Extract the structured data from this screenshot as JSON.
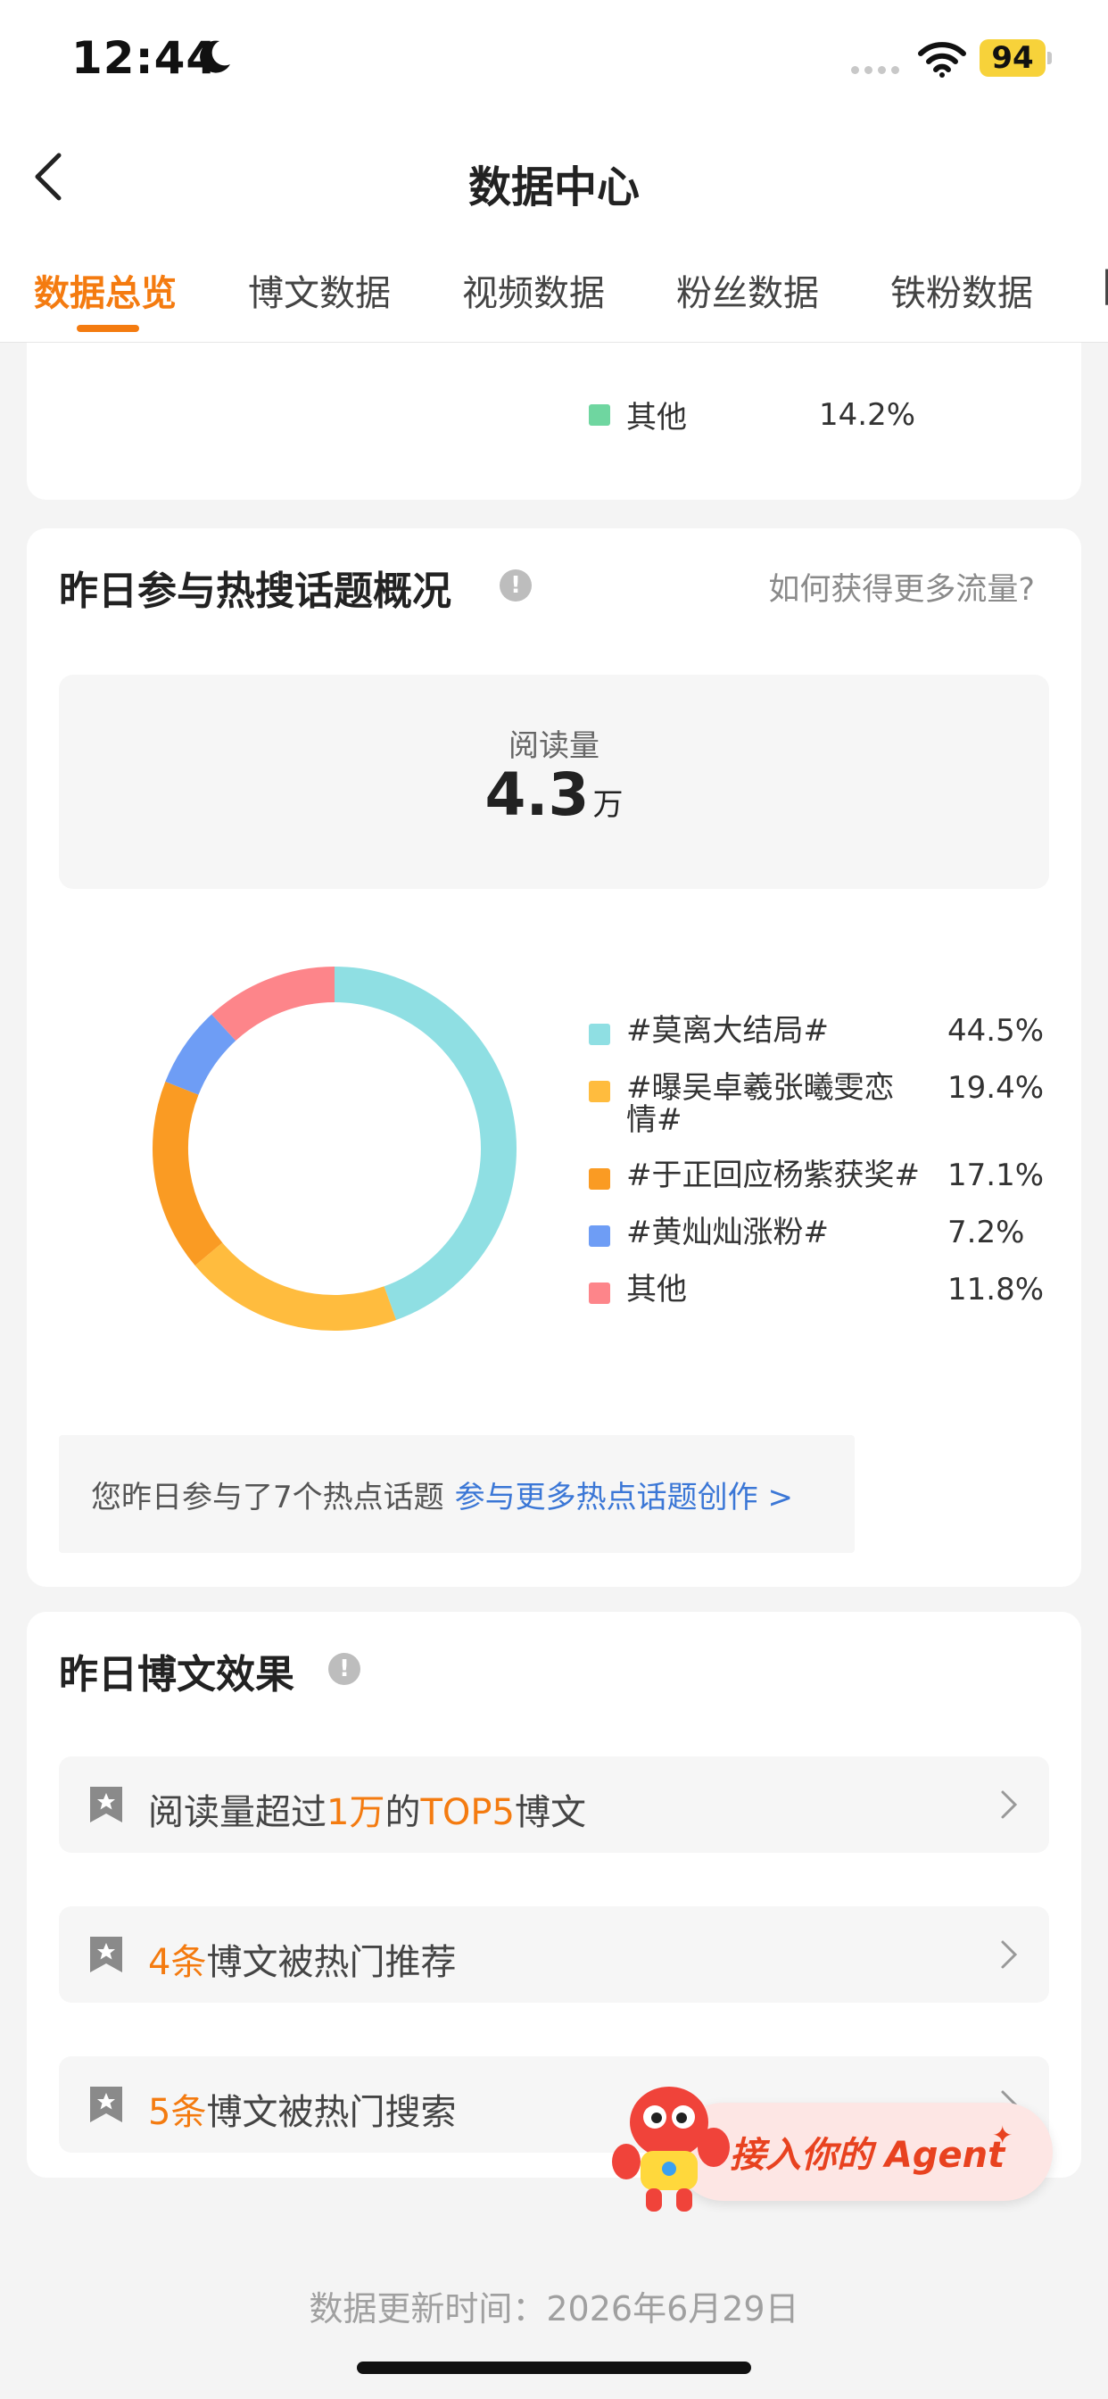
{
  "status_bar": {
    "time": "12:44",
    "battery": "94"
  },
  "header": {
    "title": "数据中心"
  },
  "tabs": [
    {
      "label": "数据总览",
      "active": true
    },
    {
      "label": "博文数据",
      "active": false
    },
    {
      "label": "视频数据",
      "active": false
    },
    {
      "label": "粉丝数据",
      "active": false
    },
    {
      "label": "铁粉数据",
      "active": false
    }
  ],
  "top_card": {
    "legend": [
      {
        "label": "其他",
        "value": "14.2%",
        "color": "#6fd6a0"
      }
    ]
  },
  "hot_topics": {
    "title": "昨日参与热搜话题概况",
    "more_link": "如何获得更多流量?",
    "read_label": "阅读量",
    "read_value": "4.3",
    "read_unit": "万",
    "chart_data": {
      "type": "pie",
      "categories": [
        "#莫离大结局#",
        "#曝吴卓羲张曦雯恋情#",
        "#于正回应杨紫获奖#",
        "#黄灿灿涨粉#",
        "其他"
      ],
      "values": [
        44.5,
        19.4,
        17.1,
        7.2,
        11.8
      ],
      "labels": [
        "44.5%",
        "19.4%",
        "17.1%",
        "7.2%",
        "11.8%"
      ],
      "colors": [
        "#8fdfe3",
        "#ffbc3e",
        "#fa9b23",
        "#6e9df5",
        "#fd858a"
      ]
    },
    "legend_name_lines": [
      [
        "#莫离大结局#"
      ],
      [
        "#曝吴卓羲张曦雯恋",
        "情#"
      ],
      [
        "#于正回应杨紫获奖#"
      ],
      [
        "#黄灿灿涨粉#"
      ],
      [
        "其他"
      ]
    ],
    "hint_text": "您昨日参与了7个热点话题",
    "hint_link": "参与更多热点话题创作 >"
  },
  "effect": {
    "title": "昨日博文效果",
    "items": [
      {
        "p1": "阅读量超过",
        "h1": "1万",
        "p2": "的",
        "h2": "TOP5",
        "p3": "博文"
      },
      {
        "h1": "4条",
        "p1": "博文被热门推荐"
      },
      {
        "h1": "5条",
        "p1": "博文被热门搜索"
      }
    ]
  },
  "agent_button": {
    "label": "接入你的 Agent"
  },
  "footer": {
    "update_time": "数据更新时间：2026年6月29日"
  }
}
